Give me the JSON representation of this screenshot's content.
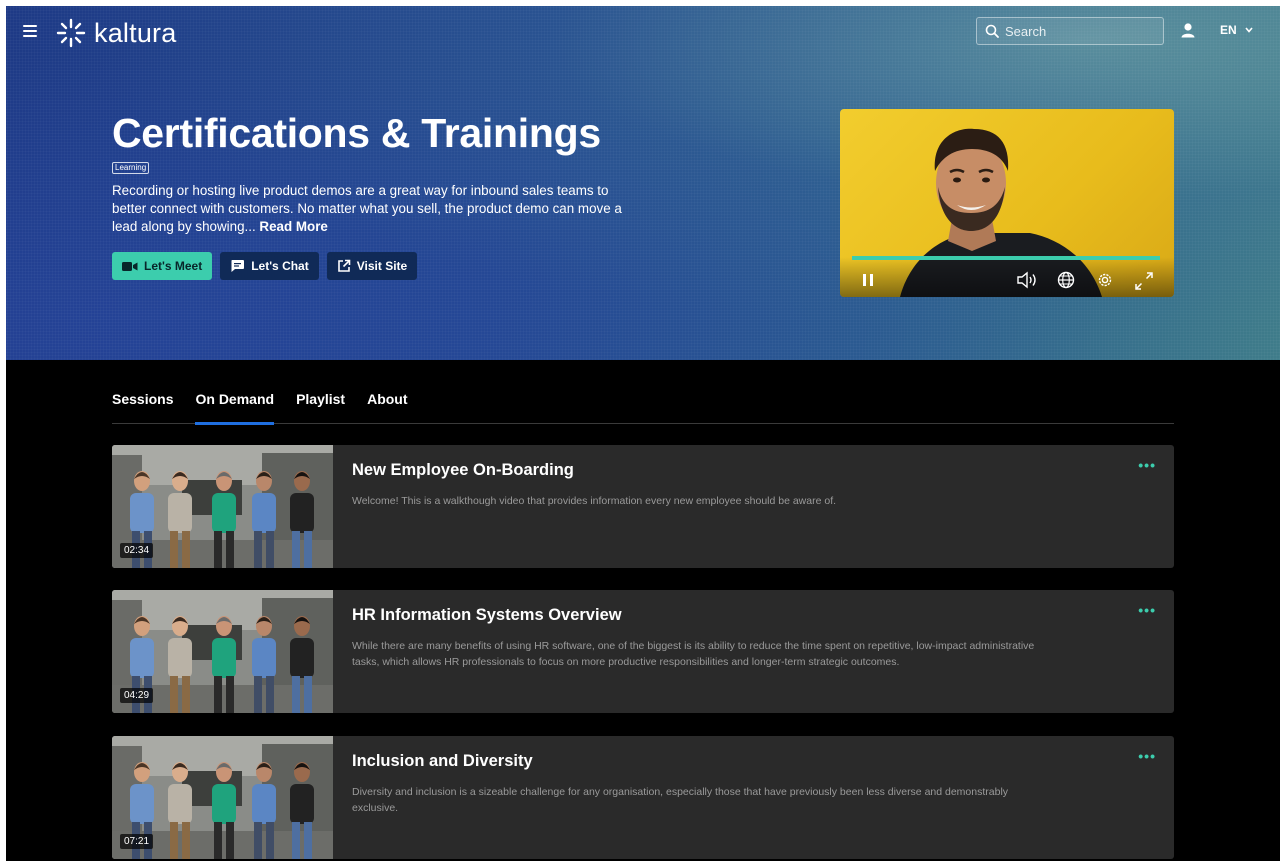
{
  "header": {
    "logo_text": "kaltura",
    "search_placeholder": "Search",
    "language": "EN"
  },
  "hero": {
    "title": "Certifications & Trainings",
    "tag": "Learning",
    "description": "Recording or hosting live product demos are a great way for inbound sales teams to better connect with customers. No matter what you sell, the product demo can move a lead along by showing...",
    "read_more": "Read More",
    "buttons": {
      "meet": "Let's Meet",
      "chat": "Let's Chat",
      "visit": "Visit Site"
    }
  },
  "player": {
    "progress": 1.0,
    "accent_color": "#3ccdad"
  },
  "tabs": [
    {
      "label": "Sessions",
      "active": false
    },
    {
      "label": "On Demand",
      "active": true
    },
    {
      "label": "Playlist",
      "active": false
    },
    {
      "label": "About",
      "active": false
    }
  ],
  "videos": [
    {
      "title": "New Employee On-Boarding",
      "description": "Welcome! This is a walkthough video that provides information every new employee should be aware of.",
      "duration": "02:34"
    },
    {
      "title": "HR Information Systems Overview",
      "description": "While there are many benefits of using HR software, one of the biggest is its ability to reduce the time spent on repetitive, low-impact administrative tasks, which allows HR professionals to focus on more productive responsibilities and longer-term strategic outcomes.",
      "duration": "04:29"
    },
    {
      "title": "Inclusion and Diversity",
      "description": "Diversity and inclusion is a sizeable challenge for any organisation, especially those that have previously been less diverse and demonstrably exclusive.",
      "duration": "07:21"
    }
  ],
  "card_more_label": "•••",
  "colors": {
    "accent": "#3ccdad",
    "tab_underline": "#1f6fe0",
    "card_bg": "#2a2a2a",
    "hero_start": "#1e3a86",
    "hero_end": "#3f7c8a"
  }
}
